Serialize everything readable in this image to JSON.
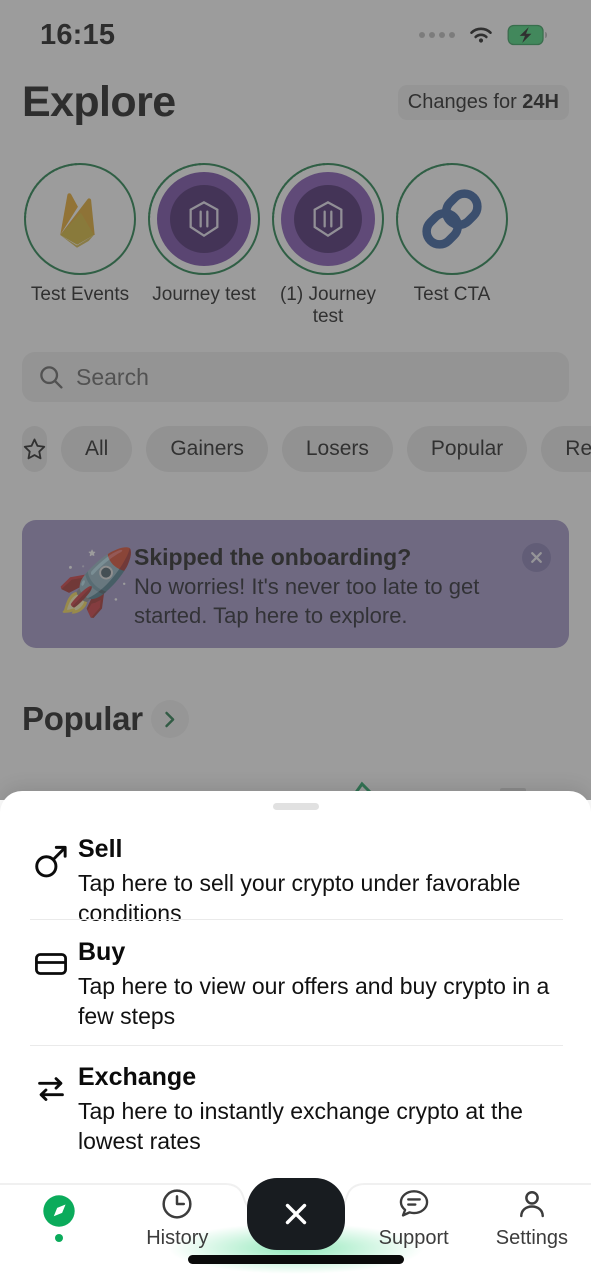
{
  "status_bar": {
    "time": "16:15",
    "wifi_icon": "wifi-icon",
    "battery_icon": "battery-charging-icon",
    "signal_icon": "signal-dots-icon"
  },
  "header": {
    "title": "Explore",
    "changes_prefix": "Changes for ",
    "changes_value": "24H"
  },
  "stories": [
    {
      "label": "Test Events",
      "icon": "firebase-flame-icon",
      "type": "flame"
    },
    {
      "label": "Journey test",
      "icon": "journey-logo-icon",
      "type": "purple"
    },
    {
      "label": "(1) Journey test",
      "icon": "journey-logo-icon",
      "type": "purple2"
    },
    {
      "label": "Test CTA",
      "icon": "chain-link-icon",
      "type": "link"
    }
  ],
  "search": {
    "placeholder": "Search",
    "value": "",
    "icon": "search-icon"
  },
  "filters": [
    {
      "label": "",
      "icon": "star-icon"
    },
    {
      "label": "All"
    },
    {
      "label": "Gainers"
    },
    {
      "label": "Losers"
    },
    {
      "label": "Popular"
    },
    {
      "label": "Rece"
    }
  ],
  "banner": {
    "emoji": "🚀",
    "title": "Skipped the onboarding?",
    "subtitle": "No worries! It's never too late to get started. Tap here to explore.",
    "close_icon": "close-icon"
  },
  "popular_section": {
    "title": "Popular",
    "chevron_icon": "chevron-right-icon"
  },
  "sheet": {
    "handle": "drag-handle",
    "items": [
      {
        "title": "Sell",
        "desc": "Tap here to sell your crypto under favorable conditions",
        "icon": "sell-arrow-icon"
      },
      {
        "title": "Buy",
        "desc": "Tap here to view our offers and buy crypto in a few steps",
        "icon": "credit-card-icon"
      },
      {
        "title": "Exchange",
        "desc": "Tap here to instantly exchange crypto at the lowest rates",
        "icon": "exchange-arrows-icon"
      }
    ]
  },
  "bottom_nav": {
    "items": [
      {
        "label": "",
        "icon": "compass-icon",
        "active": true
      },
      {
        "label": "History",
        "icon": "clock-icon",
        "active": false
      },
      {
        "label": "Support",
        "icon": "chat-icon",
        "active": false
      },
      {
        "label": "Settings",
        "icon": "person-icon",
        "active": false
      }
    ],
    "center_button": {
      "icon": "close-icon"
    }
  },
  "colors": {
    "accent_green": "#0bab5b",
    "ring_green": "#11783f",
    "banner_bg": "#9b8fc4",
    "story_purple": "#6d3fa3",
    "nav_center_bg": "#181c20",
    "dim_overlay": "rgba(74,74,74,0.55)"
  }
}
